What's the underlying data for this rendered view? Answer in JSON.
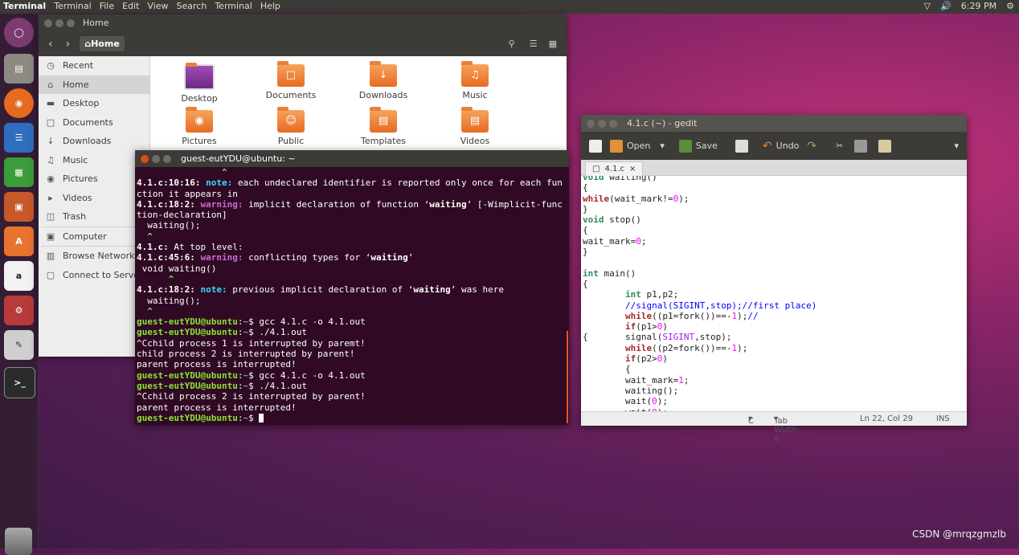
{
  "topbar": {
    "app_name": "Terminal",
    "menus": [
      "Terminal",
      "File",
      "Edit",
      "View",
      "Search",
      "Terminal",
      "Help"
    ],
    "time": "6:29 PM"
  },
  "files": {
    "title": "Home",
    "breadcrumb": "Home",
    "sidebar": [
      {
        "label": "Recent",
        "icon": "clock-icon"
      },
      {
        "label": "Home",
        "icon": "home-icon"
      },
      {
        "label": "Desktop",
        "icon": "folder-icon"
      },
      {
        "label": "Documents",
        "icon": "document-icon"
      },
      {
        "label": "Downloads",
        "icon": "download-icon"
      },
      {
        "label": "Music",
        "icon": "music-icon"
      },
      {
        "label": "Pictures",
        "icon": "camera-icon"
      },
      {
        "label": "Videos",
        "icon": "video-icon"
      },
      {
        "label": "Trash",
        "icon": "trash-icon"
      },
      {
        "label": "Computer",
        "icon": "drive-icon"
      },
      {
        "label": "Browse Network",
        "icon": "network-icon"
      },
      {
        "label": "Connect to Server",
        "icon": "server-icon"
      }
    ],
    "folders": [
      "Desktop",
      "Documents",
      "Downloads",
      "Music",
      "Pictures",
      "Public",
      "Templates",
      "Videos"
    ]
  },
  "terminal": {
    "title": "guest-eutYDU@ubuntu: ~",
    "prompt_user": "guest-eutYDU@ubuntu",
    "prompt_path": "~",
    "lines": {
      "l0": "                ^",
      "l1a": "4.1.c:10:16: ",
      "l1b": "note:",
      "l1c": " each undeclared identifier is reported only once for each fun",
      "l2": "ction it appears in",
      "l3a": "4.1.c:18:2: ",
      "l3b": "warning:",
      "l3c": " implicit declaration of function ‘",
      "l3d": "waiting",
      "l3e": "’ [-Wimplicit-func",
      "l4": "tion-declaration]",
      "l5": "  waiting();",
      "l6": "  ^",
      "l7a": "4.1.c:",
      "l7b": " At top level:",
      "l8a": "4.1.c:45:6: ",
      "l8b": "warning:",
      "l8c": " conflicting types for ‘",
      "l8d": "waiting",
      "l8e": "’",
      "l9": " void waiting()",
      "l10": "      ^",
      "l11a": "4.1.c:18:2: ",
      "l11b": "note:",
      "l11c": " previous implicit declaration of ‘",
      "l11d": "waiting",
      "l11e": "’ was here",
      "l12": "  waiting();",
      "l13": "  ^",
      "cmd1": "gcc 4.1.c -o 4.1.out",
      "cmd2": "./4.1.out",
      "out1": "^Cchild process 1 is interrupted by paremt!",
      "out2": "child process 2 is interrupted by parent!",
      "out3": "parent process is interrupted!",
      "cmd3": "gcc 4.1.c -o 4.1.out",
      "cmd4": "./4.1.out",
      "out4": "^Cchild process 2 is interrupted by parent!",
      "out5": "parent process is interrupted!"
    }
  },
  "gedit": {
    "title": "4.1.c (~) - gedit",
    "open_label": "Open",
    "save_label": "Save",
    "undo_label": "Undo",
    "tab_label": "4.1.c",
    "status": {
      "lang": "C",
      "tab_width": "Tab Width: 8",
      "position": "Ln 22, Col 29",
      "mode": "INS"
    }
  },
  "watermark": "CSDN @mrqzgmzlb",
  "colors": {
    "terminal_bg": "#300a24",
    "prompt_green": "#8ae234",
    "ubuntu_orange": "#df4a16"
  }
}
